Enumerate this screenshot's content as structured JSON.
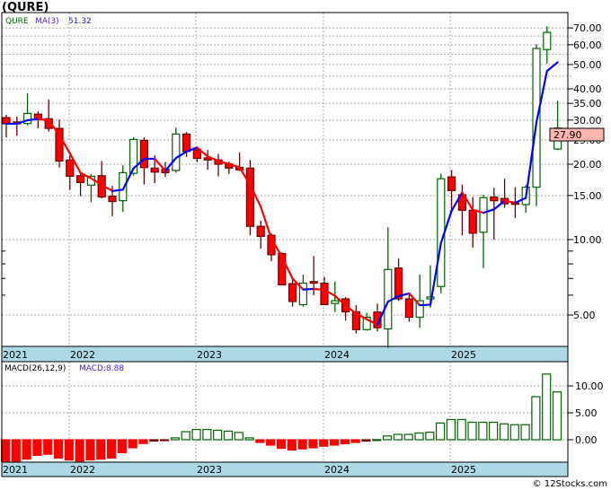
{
  "title": "(QURE)",
  "legend": {
    "symbol": "QURE",
    "ma_label": "MA(3)",
    "ma_value": "51.32"
  },
  "macd_legend": {
    "label": "MACD(26,12,9)",
    "value_label": "MACD:8.88"
  },
  "last_price_badge": "27.90",
  "copyright": "© 12Stocks.com",
  "colors": {
    "up": "#006400",
    "down": "#ff0000",
    "ma_up": "#0000ff",
    "ma_down": "#ff0000",
    "axis_strip": "#add8e6",
    "badge": "#ffb6b0"
  },
  "chart_data": [
    {
      "type": "candlestick",
      "period": "monthly",
      "scale": "log",
      "ylim": [
        3.6,
        78
      ],
      "grid": true,
      "x_tick_labels": [
        "2021",
        "2022",
        "2023",
        "2024",
        "2025"
      ],
      "y_tick_labels": [
        "70.00",
        "60.00",
        "50.00",
        "40.00",
        "35.00",
        "30.00",
        "25.00",
        "20.00",
        "15.00",
        "10.00",
        "5.00"
      ],
      "overlay": {
        "name": "MA(3)",
        "period": 3
      },
      "ohlc": [
        [
          30.7,
          31.5,
          25.6,
          29.0
        ],
        [
          29.5,
          31.0,
          26.0,
          29.0
        ],
        [
          29.1,
          38.4,
          28.6,
          31.9
        ],
        [
          31.7,
          32.5,
          27.8,
          30.1
        ],
        [
          30.4,
          36.2,
          27.0,
          27.8
        ],
        [
          27.8,
          30.1,
          19.4,
          20.6
        ],
        [
          20.8,
          21.7,
          15.8,
          17.9
        ],
        [
          18.0,
          18.4,
          14.9,
          16.9
        ],
        [
          16.5,
          18.3,
          14.1,
          17.9
        ],
        [
          18.0,
          20.6,
          14.6,
          14.8
        ],
        [
          14.9,
          16.4,
          12.4,
          14.2
        ],
        [
          14.3,
          19.8,
          12.9,
          18.5
        ],
        [
          18.4,
          25.6,
          18.0,
          25.1
        ],
        [
          24.9,
          25.6,
          16.6,
          19.4
        ],
        [
          19.3,
          21.7,
          16.8,
          18.6
        ],
        [
          19.1,
          20.4,
          17.8,
          18.5
        ],
        [
          18.9,
          28.0,
          18.5,
          26.4
        ],
        [
          26.4,
          26.9,
          21.4,
          22.5
        ],
        [
          22.8,
          23.2,
          20.4,
          21.1
        ],
        [
          21.2,
          22.8,
          19.0,
          20.8
        ],
        [
          20.8,
          22.0,
          17.9,
          20.0
        ],
        [
          20.1,
          20.5,
          18.3,
          19.3
        ],
        [
          19.4,
          22.3,
          18.8,
          19.0
        ],
        [
          19.3,
          20.8,
          10.4,
          11.3
        ],
        [
          11.3,
          11.9,
          9.2,
          10.3
        ],
        [
          10.4,
          10.6,
          8.2,
          8.7
        ],
        [
          8.8,
          8.9,
          6.6,
          6.6
        ],
        [
          6.67,
          7.0,
          5.4,
          5.66
        ],
        [
          5.5,
          7.25,
          5.4,
          6.7
        ],
        [
          6.8,
          8.6,
          6.0,
          6.7
        ],
        [
          6.7,
          7.1,
          5.5,
          5.5
        ],
        [
          5.56,
          6.8,
          5.14,
          5.7
        ],
        [
          5.8,
          5.9,
          4.75,
          5.15
        ],
        [
          5.15,
          5.48,
          4.22,
          4.37
        ],
        [
          4.37,
          5.1,
          4.33,
          4.9
        ],
        [
          5.14,
          5.55,
          4.3,
          4.45
        ],
        [
          4.4,
          11.2,
          3.7,
          7.6
        ],
        [
          7.7,
          8.4,
          5.7,
          5.8
        ],
        [
          5.8,
          6.1,
          4.7,
          4.9
        ],
        [
          4.9,
          7.25,
          4.45,
          5.7
        ],
        [
          5.8,
          7.9,
          5.35,
          5.9
        ],
        [
          6.5,
          18.3,
          6.1,
          17.5
        ],
        [
          17.8,
          19.0,
          13.1,
          15.7
        ],
        [
          15.1,
          16.6,
          10.4,
          13.1
        ],
        [
          13.1,
          14.8,
          9.3,
          10.6
        ],
        [
          10.7,
          15.1,
          7.7,
          14.7
        ],
        [
          14.8,
          16.1,
          10.0,
          14.3
        ],
        [
          14.6,
          17.5,
          13.4,
          13.9
        ],
        [
          14.0,
          16.2,
          12.2,
          13.9
        ],
        [
          13.8,
          16.5,
          12.8,
          16.2
        ],
        [
          16.2,
          60.3,
          13.6,
          58.0
        ],
        [
          57.4,
          71.0,
          50.5,
          67.2
        ],
        [
          23.0,
          35.8,
          22.8,
          27.9
        ]
      ]
    },
    {
      "type": "bar",
      "name": "MACD(26,12,9)",
      "ylim": [
        -4.3,
        13.7
      ],
      "grid": true,
      "y_tick_labels": [
        "10.00",
        "5.00",
        "0.00"
      ],
      "x_tick_labels": [
        "2021",
        "2022",
        "2023",
        "2024",
        "2025"
      ],
      "values": [
        -4.7,
        -4.4,
        -3.6,
        -2.9,
        -2.7,
        -3.4,
        -3.75,
        -4.0,
        -3.75,
        -3.6,
        -3.4,
        -2.4,
        -1.5,
        -0.7,
        -0.25,
        -0.05,
        0.35,
        1.5,
        1.9,
        1.9,
        1.75,
        1.6,
        1.35,
        0.35,
        -0.5,
        -1.0,
        -1.6,
        -1.9,
        -1.7,
        -1.5,
        -1.2,
        -1.0,
        -0.75,
        -0.5,
        -0.25,
        0.02,
        0.7,
        1.0,
        1.0,
        1.25,
        1.4,
        3.1,
        3.75,
        3.75,
        3.25,
        3.25,
        3.25,
        2.95,
        2.8,
        2.8,
        8.0,
        12.2,
        8.88
      ]
    }
  ]
}
